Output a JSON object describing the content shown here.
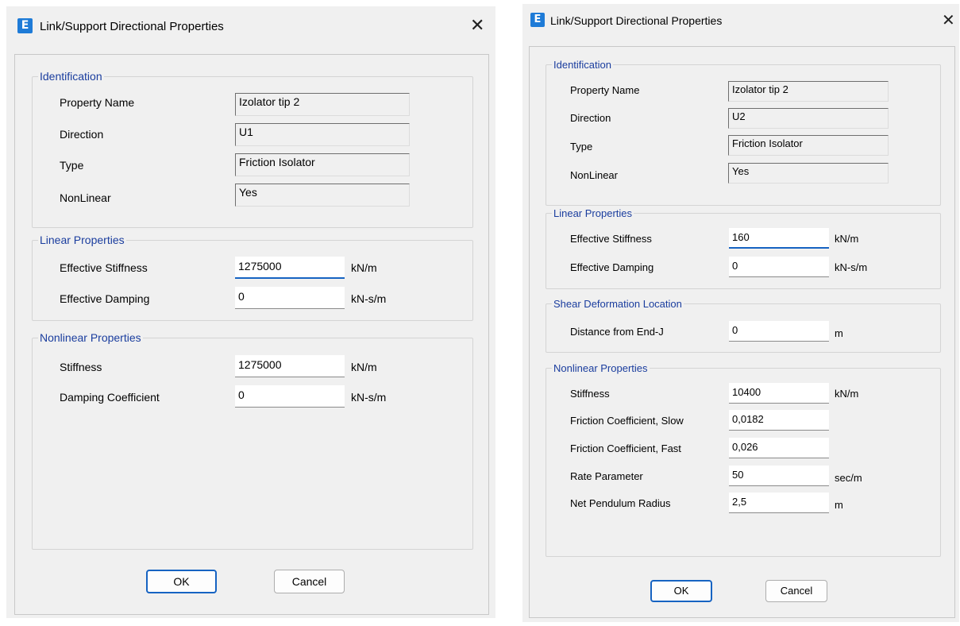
{
  "left_dialog": {
    "title": "Link/Support Directional Properties",
    "app_icon": "E",
    "close_glyph": "✕",
    "identification": {
      "legend": "Identification",
      "property_name_label": "Property Name",
      "property_name_value": "Izolator tip 2",
      "direction_label": "Direction",
      "direction_value": "U1",
      "type_label": "Type",
      "type_value": "Friction Isolator",
      "nonlinear_label": "NonLinear",
      "nonlinear_value": "Yes"
    },
    "linear": {
      "legend": "Linear Properties",
      "eff_stiffness_label": "Effective Stiffness",
      "eff_stiffness_value": "1275000",
      "eff_stiffness_unit": "kN/m",
      "eff_damping_label": "Effective Damping",
      "eff_damping_value": "0",
      "eff_damping_unit": "kN-s/m"
    },
    "nonlinear": {
      "legend": "Nonlinear Properties",
      "stiffness_label": "Stiffness",
      "stiffness_value": "1275000",
      "stiffness_unit": "kN/m",
      "damping_coeff_label": "Damping Coefficient",
      "damping_coeff_value": "0",
      "damping_coeff_unit": "kN-s/m"
    },
    "ok_label": "OK",
    "cancel_label": "Cancel"
  },
  "right_dialog": {
    "title": "Link/Support Directional Properties",
    "app_icon": "E",
    "close_glyph": "✕",
    "identification": {
      "legend": "Identification",
      "property_name_label": "Property Name",
      "property_name_value": "Izolator tip 2",
      "direction_label": "Direction",
      "direction_value": "U2",
      "type_label": "Type",
      "type_value": "Friction Isolator",
      "nonlinear_label": "NonLinear",
      "nonlinear_value": "Yes"
    },
    "linear": {
      "legend": "Linear Properties",
      "eff_stiffness_label": "Effective Stiffness",
      "eff_stiffness_value": "160",
      "eff_stiffness_unit": "kN/m",
      "eff_damping_label": "Effective Damping",
      "eff_damping_value": "0",
      "eff_damping_unit": "kN-s/m"
    },
    "shear": {
      "legend": "Shear Deformation Location",
      "distance_label": "Distance from End-J",
      "distance_value": "0",
      "distance_unit": "m"
    },
    "nonlinear": {
      "legend": "Nonlinear Properties",
      "stiffness_label": "Stiffness",
      "stiffness_value": "10400",
      "stiffness_unit": "kN/m",
      "friction_slow_label": "Friction Coefficient, Slow",
      "friction_slow_value": "0,0182",
      "friction_fast_label": "Friction Coefficient, Fast",
      "friction_fast_value": "0,026",
      "rate_label": "Rate Parameter",
      "rate_value": "50",
      "rate_unit": "sec/m",
      "radius_label": "Net Pendulum Radius",
      "radius_value": "2,5",
      "radius_unit": "m"
    },
    "ok_label": "OK",
    "cancel_label": "Cancel"
  }
}
